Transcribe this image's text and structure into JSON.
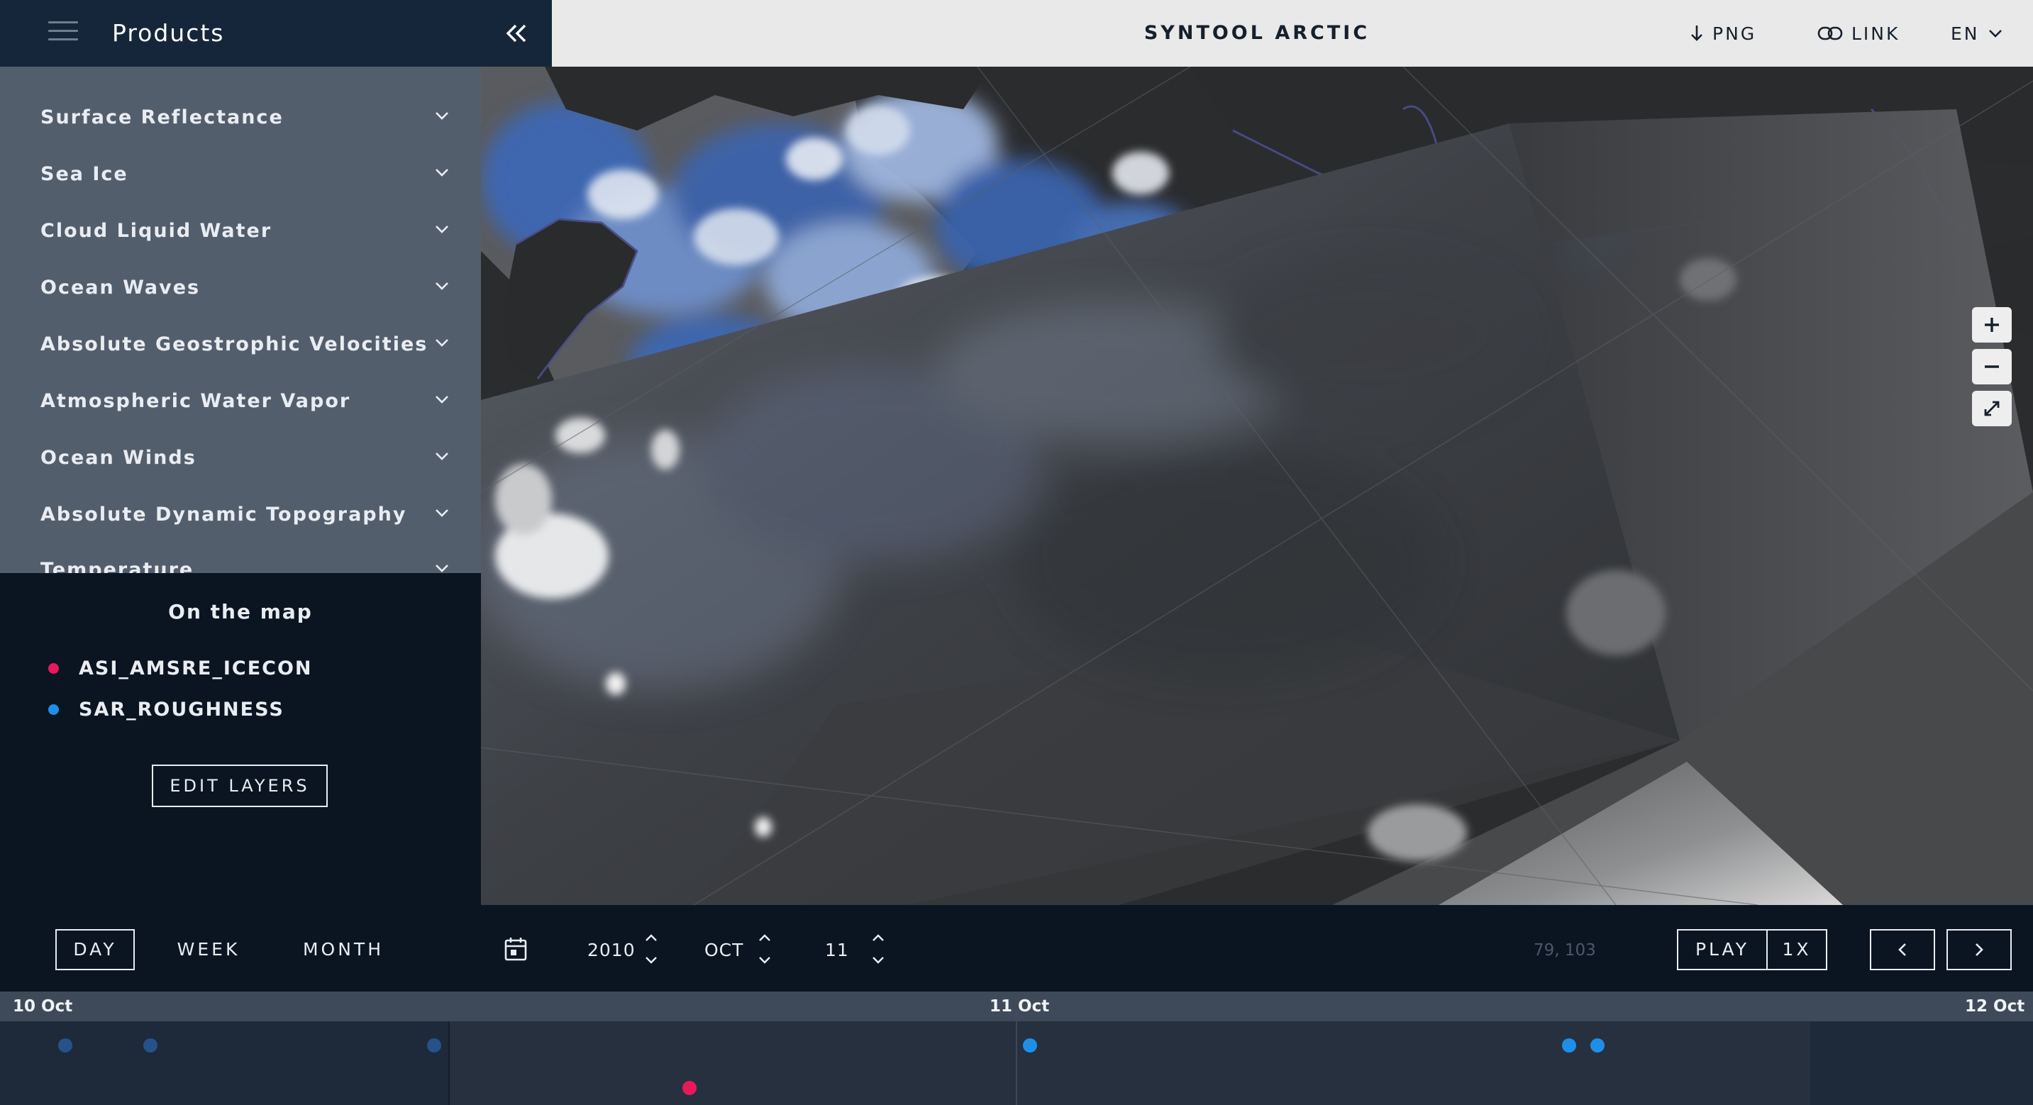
{
  "app": {
    "title": "SYNTOOL ARCTIC"
  },
  "topbar": {
    "png_label": "PNG",
    "link_label": "LINK",
    "lang_label": "EN",
    "icons": {
      "png": "download-arrow-icon",
      "link": "link-icon",
      "lang": "chevron-down-icon"
    }
  },
  "sidebar": {
    "title": "Products",
    "products": [
      {
        "label": "Surface Reflectance"
      },
      {
        "label": "Sea Ice"
      },
      {
        "label": "Cloud Liquid Water"
      },
      {
        "label": "Ocean Waves"
      },
      {
        "label": "Absolute Geostrophic Velocities"
      },
      {
        "label": "Atmospheric Water Vapor"
      },
      {
        "label": "Ocean Winds"
      },
      {
        "label": "Absolute Dynamic Topography"
      },
      {
        "label": "Temperature"
      }
    ],
    "on_map": {
      "title": "On the map",
      "layers": [
        {
          "label": "ASI_AMSRE_ICECON",
          "color": "#e8195a"
        },
        {
          "label": "SAR_ROUGHNESS",
          "color": "#1e8fe8"
        }
      ],
      "edit_label": "EDIT LAYERS"
    }
  },
  "controls": {
    "periods": [
      {
        "label": "DAY",
        "active": true
      },
      {
        "label": "WEEK",
        "active": false
      },
      {
        "label": "MONTH",
        "active": false
      }
    ],
    "year": "2010",
    "month": "OCT",
    "day": "11",
    "coords": "79, 103",
    "play_label": "PLAY",
    "speed_label": "1X"
  },
  "timeline": {
    "labels": {
      "start": "10 Oct",
      "mid": "11 Oct",
      "end": "12 Oct"
    },
    "colors": {
      "dim": "#25528a",
      "bright": "#1e8fe8",
      "red": "#e8195a"
    }
  },
  "colors": {
    "sidebar_dark": "#0b1522",
    "header_dark": "#16263a",
    "ice_blue": "#3a64b0"
  }
}
